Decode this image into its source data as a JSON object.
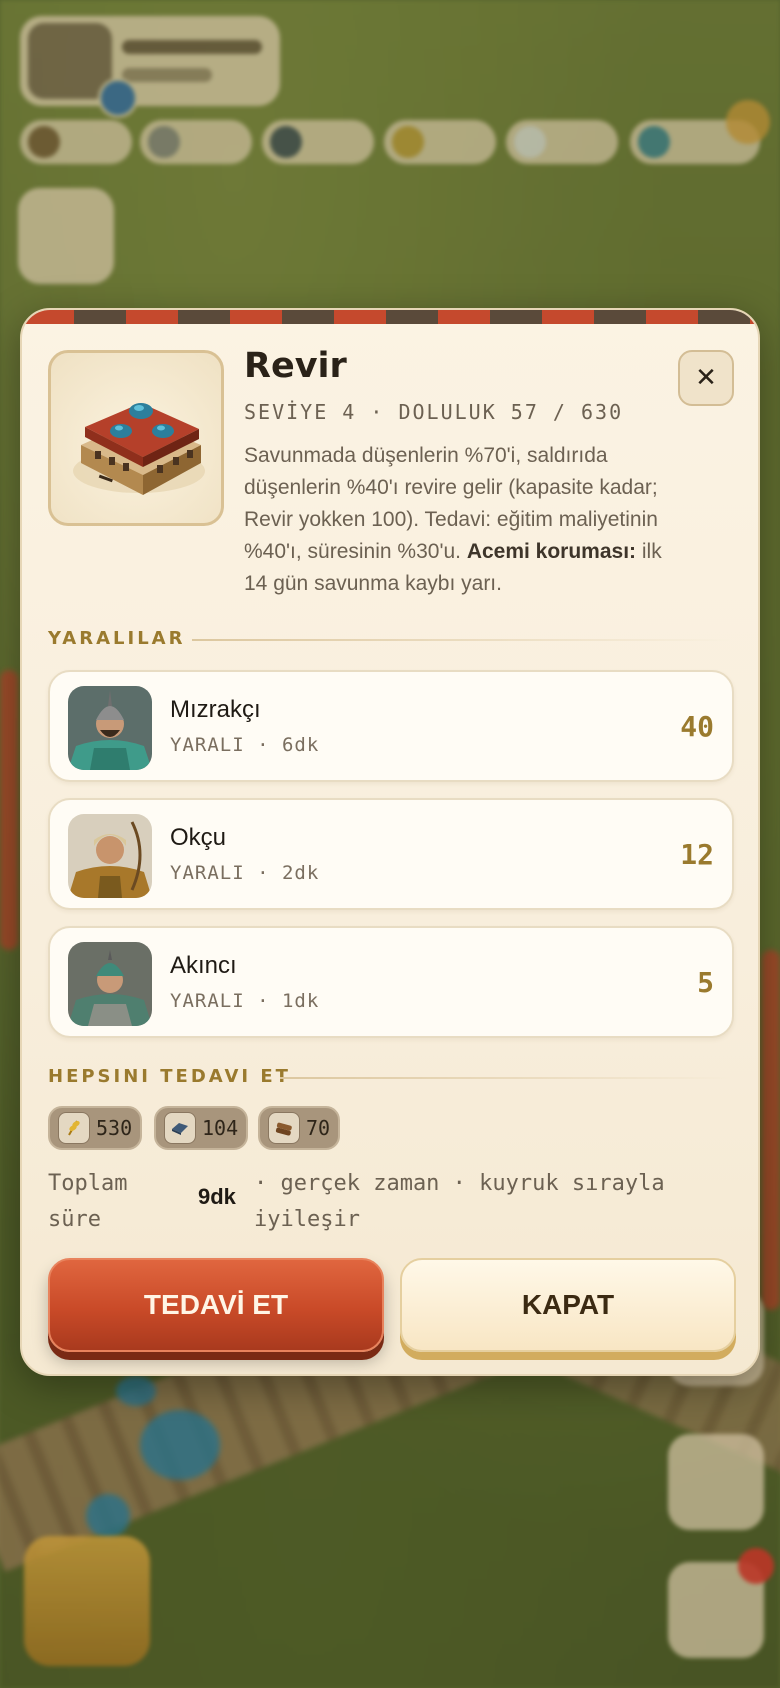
{
  "building": {
    "title": "Revir",
    "meta": "SEVİYE 4 · DOLULUK 57 / 630",
    "description_parts": {
      "main": "Savunmada düşenlerin %70'i, saldırıda düşenlerin %40'ı revire gelir (kapasite kadar; Revir yokken 100). Tedavi: eğitim maliyetinin %40'ı, süresinin %30'u. ",
      "bold": "Acemi koruması:",
      "tail": " ilk 14 gün savunma kaybı yarı."
    },
    "close_symbol": "✕"
  },
  "wounded": {
    "label": "YARALILAR",
    "units": [
      {
        "name": "Mızrakçı",
        "status": "YARALI · 6dk",
        "count": "40"
      },
      {
        "name": "Okçu",
        "status": "YARALI · 2dk",
        "count": "12"
      },
      {
        "name": "Akıncı",
        "status": "YARALI · 1dk",
        "count": "5"
      }
    ]
  },
  "heal_all": {
    "label": "HEPSINI TEDAVI ET",
    "costs": [
      {
        "icon": "wheat-icon",
        "value": "530"
      },
      {
        "icon": "iron-icon",
        "value": "104"
      },
      {
        "icon": "wood-icon",
        "value": "70"
      }
    ],
    "time_prefix": "Toplam süre",
    "time_value": "9dk",
    "time_suffix": "· gerçek zaman · kuyruk sırayla iyileşir"
  },
  "buttons": {
    "heal": "TEDAVİ ET",
    "close": "KAPAT"
  },
  "colors": {
    "accent_gold": "#9a7a2e",
    "primary_red": "#c94a28",
    "panel_bg": "#fbf3e3"
  }
}
